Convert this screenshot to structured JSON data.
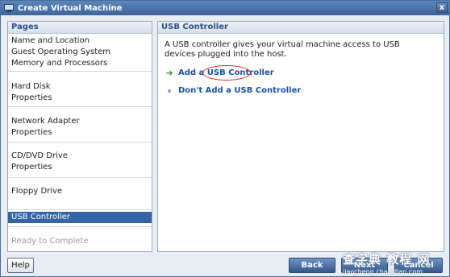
{
  "window": {
    "title": "Create Virtual Machine",
    "close_glyph": "x"
  },
  "pages_pane": {
    "header": "Pages",
    "groups": [
      [
        "Name and Location",
        "Guest Operating System",
        "Memory and Processors"
      ],
      [
        "Hard Disk",
        "Properties"
      ],
      [
        "Network Adapter",
        "Properties"
      ],
      [
        "CD/DVD Drive",
        "Properties"
      ],
      [
        "Floppy Drive"
      ],
      [
        "USB Controller"
      ],
      [
        "Ready to Complete"
      ]
    ],
    "selected": "USB Controller",
    "disabled": [
      "Ready to Complete"
    ]
  },
  "content": {
    "header": "USB Controller",
    "description": "A USB controller gives your virtual machine access to USB devices plugged into the host.",
    "options": {
      "add_prefix": "Add a ",
      "add_circled": "USB Controller",
      "dont_add": "Don't Add a USB Controller"
    }
  },
  "footer": {
    "help": "Help",
    "back": "Back",
    "next": "Next",
    "cancel": "Cancel"
  },
  "watermark": {
    "main": "查字典 教程 网",
    "url": "jiaocheng.chazidian.com"
  },
  "colors": {
    "title_bar": "#4a73a8",
    "selected_page": "#3464a4",
    "link": "#1a4fa8",
    "annotation_circle": "#d8241e"
  },
  "icons": {
    "add_option": "green-arrow-icon",
    "dont_add_option": "bullet-icon"
  }
}
